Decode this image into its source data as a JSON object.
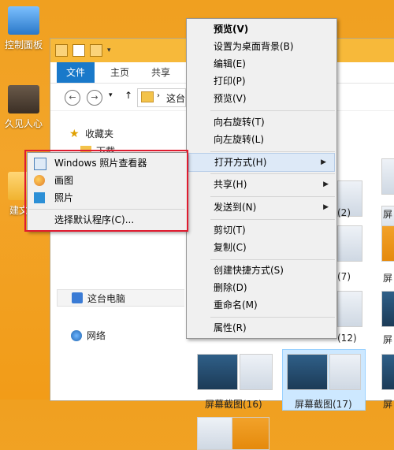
{
  "desktop": {
    "icons": [
      {
        "label": "控制面板"
      },
      {
        "label": "久见人心"
      },
      {
        "label": "建文件"
      }
    ]
  },
  "explorer": {
    "tabs": [
      "文件",
      "主页",
      "共享"
    ],
    "address_partial": "这台",
    "nav": {
      "favorites": "收藏夹",
      "downloads_partial": "下载",
      "this_pc": "这台电脑",
      "network": "网络"
    },
    "items": [
      {
        "label": "屏幕截图(16)"
      },
      {
        "label": "屏幕截图(17)"
      },
      {
        "label": "(2)"
      },
      {
        "label": "(7)"
      },
      {
        "label": "(12)"
      },
      {
        "label": "屏"
      },
      {
        "label": "屏"
      },
      {
        "label": "屏"
      },
      {
        "label": "屏"
      }
    ]
  },
  "context_menu": {
    "items": [
      {
        "label": "预览(V)",
        "bold": true
      },
      {
        "label": "设置为桌面背景(B)"
      },
      {
        "label": "编辑(E)"
      },
      {
        "label": "打印(P)"
      },
      {
        "label": "预览(V)"
      },
      {
        "label": "向右旋转(T)"
      },
      {
        "label": "向左旋转(L)"
      },
      {
        "label": "打开方式(H)",
        "submenu": true
      },
      {
        "label": "共享(H)",
        "submenu": true
      },
      {
        "label": "发送到(N)",
        "submenu": true
      },
      {
        "label": "剪切(T)"
      },
      {
        "label": "复制(C)"
      },
      {
        "label": "创建快捷方式(S)"
      },
      {
        "label": "删除(D)"
      },
      {
        "label": "重命名(M)"
      },
      {
        "label": "属性(R)"
      }
    ]
  },
  "open_with_menu": {
    "items": [
      {
        "label": "Windows 照片查看器",
        "icon": "photo-viewer-icon"
      },
      {
        "label": "画图",
        "icon": "paint-icon"
      },
      {
        "label": "照片",
        "icon": "photos-icon"
      },
      {
        "label": "选择默认程序(C)..."
      }
    ]
  },
  "colors": {
    "accent": "#1979ca",
    "highlight_border": "#e01b2f",
    "desktop_bg": "#f29c18"
  }
}
